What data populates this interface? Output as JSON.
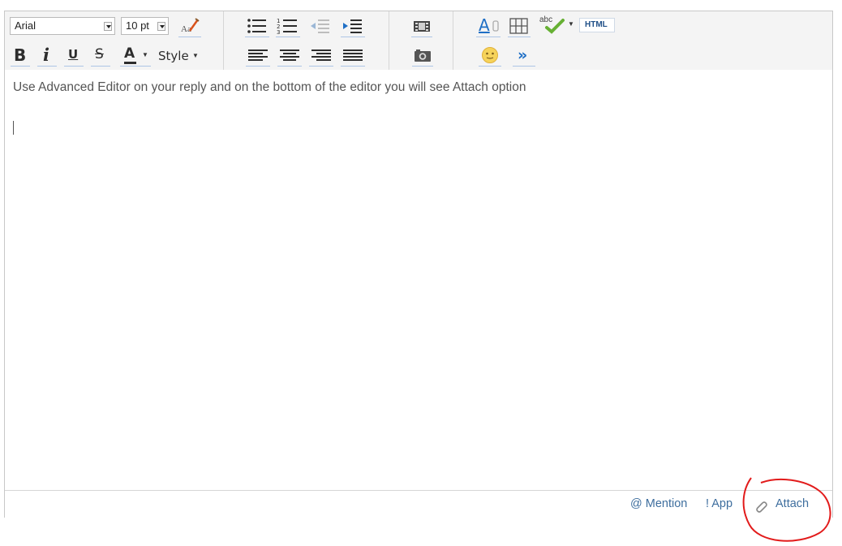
{
  "toolbar": {
    "font_family": "Arial",
    "font_size": "10 pt",
    "bold": "B",
    "italic": "i",
    "underline": "U",
    "strike": "S",
    "font_color": "A",
    "style_label": "Style",
    "highlight_letter": "A",
    "spell_label": "abc",
    "html_label": "HTML",
    "more_label": "»"
  },
  "content": {
    "text": "Use Advanced Editor on your reply and on the bottom of the editor you will see Attach option"
  },
  "footer": {
    "mention": "@ Mention",
    "app": "! App",
    "attach": "Attach"
  },
  "colors": {
    "link": "#3e6e9e",
    "annotation": "#e21b1b",
    "accent_blue": "#1f6fc5"
  },
  "icons": [
    "clear-format-icon",
    "bullet-list-icon",
    "numbered-list-icon",
    "outdent-icon",
    "indent-icon",
    "align-left-icon",
    "align-center-icon",
    "align-right-icon",
    "justify-icon",
    "video-icon",
    "camera-icon",
    "highlight-icon",
    "table-icon",
    "spellcheck-icon",
    "emoji-icon",
    "more-icon",
    "paperclip-icon"
  ]
}
